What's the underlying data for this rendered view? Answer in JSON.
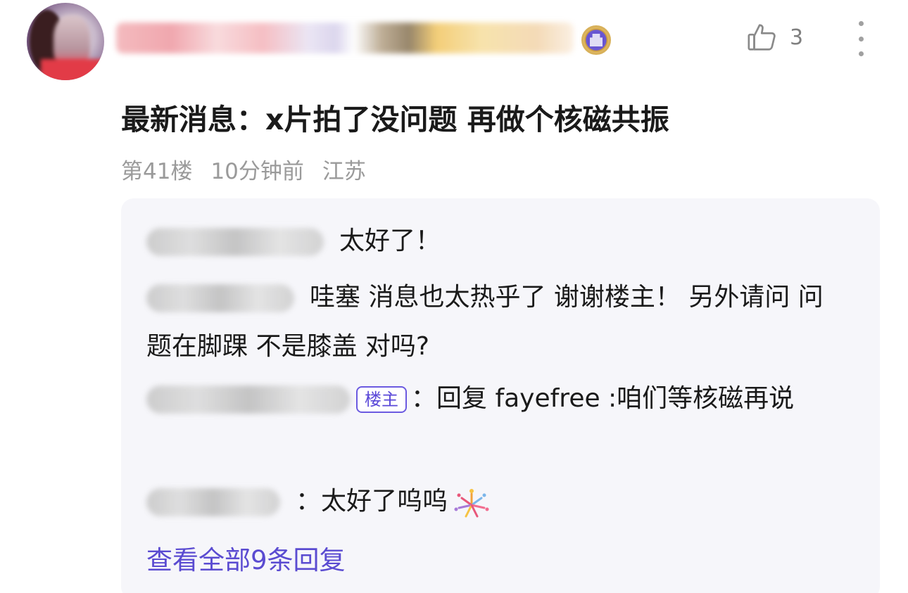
{
  "post": {
    "title": "最新消息：x片拍了没问题 再做个核磁共振",
    "like_count": "3",
    "meta": {
      "floor": "第41楼",
      "time": "10分钟前",
      "location": "江苏"
    }
  },
  "replies": [
    {
      "text": "太好了！"
    },
    {
      "text": "哇塞 消息也太热乎了 谢谢楼主！ 另外请问 问题在脚踝 不是膝盖 对吗?"
    },
    {
      "owner_tag": "楼主",
      "text": "：回复 fayefree :咱们等核磁再说"
    },
    {
      "text": "：太好了呜呜"
    }
  ],
  "view_all": "查看全部9条回复",
  "colors": {
    "accent": "#5a4bd1",
    "meta_gray": "#9a9a9a",
    "reply_bg": "#f6f6fa"
  },
  "icons": [
    "thumbs-up-icon",
    "more-vertical-icon",
    "fireworks-emoji",
    "vip-badge-icon"
  ]
}
